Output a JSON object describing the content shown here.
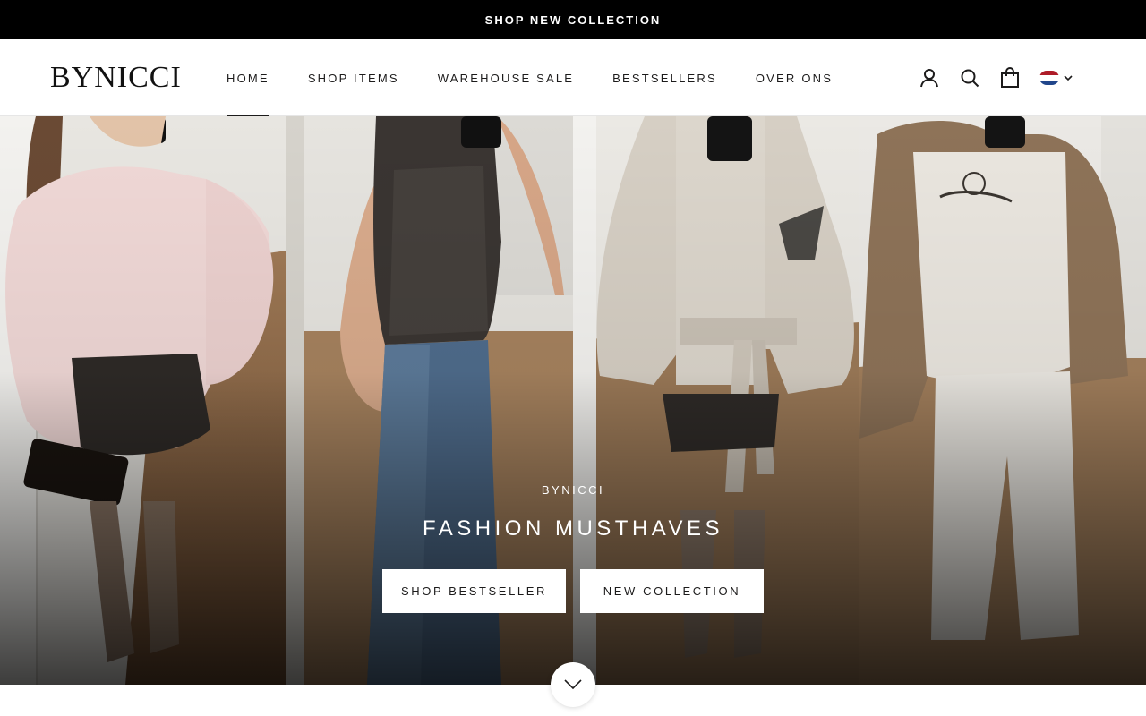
{
  "announcement": {
    "text": "SHOP NEW COLLECTION"
  },
  "header": {
    "logo": "BYNICCI",
    "nav": [
      {
        "label": "HOME",
        "active": true
      },
      {
        "label": "SHOP ITEMS",
        "active": false
      },
      {
        "label": "WAREHOUSE SALE",
        "active": false
      },
      {
        "label": "BESTSELLERS",
        "active": false
      },
      {
        "label": "OVER ONS",
        "active": false
      }
    ],
    "icons": [
      "account-icon",
      "search-icon",
      "cart-icon"
    ],
    "language": {
      "flag": "netherlands-flag",
      "flag_colors": [
        "#ae1c28",
        "#ffffff",
        "#21468b"
      ]
    }
  },
  "hero": {
    "subtitle": "BYNICCI",
    "title": "FASHION MUSTHAVES",
    "buttons": [
      "SHOP BESTSELLER",
      "NEW COLLECTION"
    ],
    "panels": [
      {
        "name": "pink-sweater-photo"
      },
      {
        "name": "sequin-top-photo"
      },
      {
        "name": "beige-cape-photo"
      },
      {
        "name": "brown-jacket-photo"
      }
    ]
  },
  "scroll_icon": "chevron-down-icon"
}
